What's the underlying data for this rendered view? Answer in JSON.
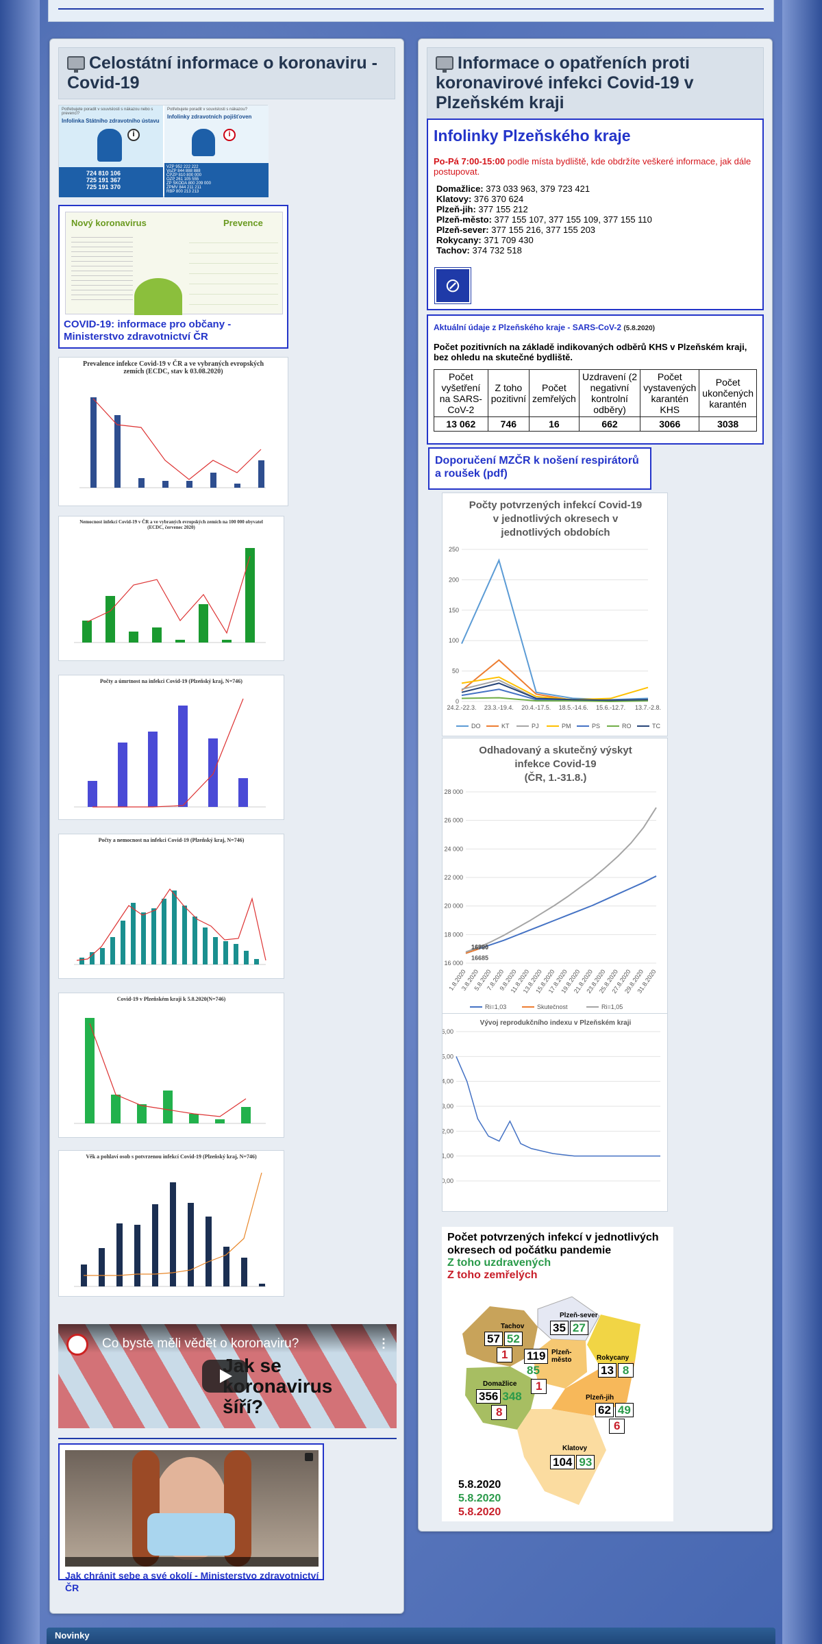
{
  "left_panel": {
    "title": "Celostátní informace o koronaviru - Covid-19",
    "infolinka": {
      "left_small": "Potřebujete poradit v souvislosti s nákazou nebo s prevencí?",
      "left_title": "Infolinka Státního zdravotního ústavu",
      "left_phones": [
        "724 810 106",
        "725 191 367",
        "725 191 370"
      ],
      "right_small": "Potřebujete poradit v souvislosti s nákazou?",
      "right_title": "Infolinky zdravotních pojišťoven",
      "right_rows": [
        "VZP 952 222 222",
        "VoZP 844 888 888",
        "ČPZP 810 800 000",
        "OZP 261 105 555",
        "ZP ŠKODA 800 209 000",
        "ZPMV 844 211 211",
        "RBP 800 213 213"
      ]
    },
    "novy": {
      "title": "Nový koronavirus",
      "prevence": "Prevence",
      "caption": "COVID-19: informace pro občany - Ministerstvo zdravotnictví ČR"
    },
    "video": {
      "title": "Co byste měli vědět o koronaviru?",
      "overlay": "Jak se koronavirus šíří?"
    },
    "mask_caption": "Jak chránit sebe a své okolí - Ministerstvo zdravotnictví ČR",
    "chart1_title": "Prevalence infekce Covid-19 v ČR a ve vybraných evropských zemích (ECDC, stav k 03.08.2020)",
    "chart2_title": "Nemocnost infekcí Covid-19 v ČR a ve vybraných evropských zemích na 100 000 obyvatel (ECDC, červenec 2020)",
    "chart3_title": "Počty a úmrtnost na infekci Covid-19 (Plzeňský kraj, N=746)",
    "chart4_title": "Počty a nemocnost na infekci Covid-19 (Plzeňský kraj, N=746)",
    "chart5_title": "Covid-19 v Plzeňském kraji k 5.8.2020(N=746)",
    "chart6_title": "Věk a pohlaví osob s potvrzenou infekcí Covid-19 (Plzeňský kraj, N=746)"
  },
  "right_panel": {
    "title": "Informace o opatřeních proti koronavirové infekci Covid-19 v Plzeňském kraji",
    "infolinky": {
      "title": "Infolinky Plzeňského kraje",
      "hours": "Po-Pá 7:00-15:00",
      "hours_rest": " podle místa bydliště, kde obdržíte veškeré informace, jak dále postupovat.",
      "rows": [
        [
          "Domažlice:",
          "373 033 963, 379 723 421"
        ],
        [
          "Klatovy:",
          "376 370 624"
        ],
        [
          "Plzeň-jih:",
          "377 155 212"
        ],
        [
          "Plzeň-město:",
          "377 155 107, 377 155 109, 377 155 110"
        ],
        [
          "Plzeň-sever:",
          "377 155 216, 377 155 203"
        ],
        [
          "Rokycany:",
          "371 709 430"
        ],
        [
          "Tachov:",
          "374 732 518"
        ]
      ]
    },
    "aktualni": {
      "title": "Aktuální údaje z Plzeňského kraje - SARS-CoV-2",
      "date": "(5.8.2020)",
      "subtitle": "Počet pozitivních na základě indikovaných odběrů KHS v Plzeňském kraji, bez ohledu na skutečné bydliště.",
      "headers": [
        "Počet vyšetření na SARS-CoV-2",
        "Z toho pozitivní",
        "Počet zemřelých",
        "Uzdravení (2 negativní kontrolní odběry)",
        "Počet vystavených karantén KHS",
        "Počet ukončených karantén"
      ],
      "values": [
        "13 062",
        "746",
        "16",
        "662",
        "3066",
        "3038"
      ]
    },
    "doporuceni": "Doporučení MZČR k nošení respirátorů a roušek (pdf)",
    "map": {
      "title": "Počet potvrzených infekcí v jednotlivých okresech od počátku pandemie",
      "green_label": "Z toho uzdravených",
      "red_label": "Z toho zemřelých",
      "dates": [
        "5.8.2020",
        "5.8.2020",
        "5.8.2020"
      ],
      "districts": [
        {
          "name": "Tachov",
          "total": "57",
          "recovered": "52",
          "dead": "1"
        },
        {
          "name": "Plzeň-sever",
          "total": "35",
          "recovered": "27",
          "dead": ""
        },
        {
          "name": "Plzeň-město",
          "total": "119",
          "recovered": "85",
          "dead": "1"
        },
        {
          "name": "Rokycany",
          "total": "13",
          "recovered": "8",
          "dead": ""
        },
        {
          "name": "Domažlice",
          "total": "356",
          "recovered": "348",
          "dead": "8"
        },
        {
          "name": "Plzeň-jih",
          "total": "62",
          "recovered": "49",
          "dead": "6"
        },
        {
          "name": "Klatovy",
          "total": "104",
          "recovered": "93",
          "dead": ""
        }
      ]
    }
  },
  "footer": {
    "news_label": "Novinky"
  },
  "chart_data": [
    {
      "type": "line",
      "title": "Počty potvrzených infekcí Covid-19 v jednotlivých okresech v jednotlivých obdobích",
      "categories": [
        "24.2.-22.3.",
        "23.3.-19.4.",
        "20.4.-17.5.",
        "18.5.-14.6.",
        "15.6.-12.7.",
        "13.7.-2.8."
      ],
      "ylim": [
        0,
        250
      ],
      "yticks": [
        0,
        50,
        100,
        150,
        200,
        250
      ],
      "series": [
        {
          "name": "DO",
          "color": "#5b9bd5",
          "values": [
            95,
            232,
            15,
            5,
            3,
            5
          ]
        },
        {
          "name": "KT",
          "color": "#ed7d31",
          "values": [
            18,
            68,
            12,
            2,
            2,
            3
          ]
        },
        {
          "name": "PJ",
          "color": "#a5a5a5",
          "values": [
            20,
            35,
            5,
            2,
            1,
            2
          ]
        },
        {
          "name": "PM",
          "color": "#ffc000",
          "values": [
            30,
            40,
            8,
            3,
            5,
            23
          ]
        },
        {
          "name": "PS",
          "color": "#4472c4",
          "values": [
            10,
            20,
            3,
            1,
            1,
            2
          ]
        },
        {
          "name": "RO",
          "color": "#70ad47",
          "values": [
            5,
            6,
            1,
            1,
            0,
            1
          ]
        },
        {
          "name": "TC",
          "color": "#264478",
          "values": [
            15,
            30,
            5,
            3,
            2,
            3
          ]
        }
      ]
    },
    {
      "type": "line",
      "title": "Odhadovaný a skutečný výskyt infekce Covid-19 (ČR, 1.-31.8.)",
      "ylim": [
        16000,
        28000
      ],
      "yticks": [
        "16 000",
        "18 000",
        "20 000",
        "22 000",
        "24 000",
        "26 000",
        "28 000"
      ],
      "x": [
        "1.8.2020",
        "3.8.2020",
        "5.8.2020",
        "7.8.2020",
        "9.8.2020",
        "11.8.2020",
        "13.8.2020",
        "15.8.2020",
        "17.8.2020",
        "19.8.2020",
        "21.8.2020",
        "23.8.2020",
        "25.8.2020",
        "27.8.2020",
        "29.8.2020",
        "31.8.2020"
      ],
      "series": [
        {
          "name": "Ri=1,03",
          "color": "#4472c4",
          "values": [
            16685,
            16996,
            17300,
            17600,
            17950,
            18300,
            18650,
            19000,
            19350,
            19700,
            20050,
            20450,
            20850,
            21250,
            21650,
            22100
          ]
        },
        {
          "name": "Skutečnost",
          "color": "#ed7d31",
          "values": [
            16685,
            16996,
            null,
            null,
            null,
            null,
            null,
            null,
            null,
            null,
            null,
            null,
            null,
            null,
            null,
            null
          ]
        },
        {
          "name": "Ri=1,05",
          "color": "#a5a5a5",
          "values": [
            16780,
            17100,
            17500,
            17950,
            18450,
            18950,
            19500,
            20050,
            20650,
            21300,
            21950,
            22700,
            23500,
            24400,
            25500,
            26900
          ]
        }
      ],
      "labels": [
        "16685",
        "16996",
        "16780"
      ]
    },
    {
      "type": "line",
      "title": "Vývoj reprodukčního indexu v Plzeňském kraji",
      "ylim": [
        0,
        6
      ],
      "yticks": [
        "0,00",
        "1,00",
        "2,00",
        "3,00",
        "4,00",
        "5,00",
        "6,00"
      ],
      "series": [
        {
          "name": "R",
          "color": "#4472c4",
          "values": [
            5.0,
            4.0,
            2.5,
            1.8,
            1.6,
            2.4,
            1.5,
            1.3,
            1.2,
            1.1,
            1.05,
            1.0,
            1.0,
            1.0,
            1.0,
            1.0,
            1.0,
            1.0,
            1.0,
            1.0
          ]
        }
      ]
    }
  ]
}
